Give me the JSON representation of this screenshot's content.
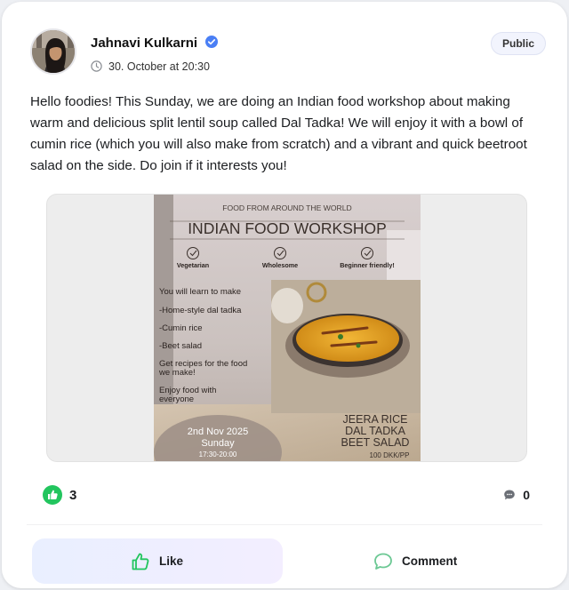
{
  "post": {
    "author_name": "Jahnavi Kulkarni",
    "timestamp": "30. October at 20:30",
    "visibility": "Public",
    "body": "Hello foodies! This Sunday, we are doing an Indian food workshop about making warm and delicious split lentil soup called Dal Tadka! We will enjoy it with a bowl of cumin rice (which you will also make from scratch) and a vibrant and quick beetroot salad on the side. Do join if it interests you!"
  },
  "poster": {
    "kicker": "FOOD FROM AROUND THE WORLD",
    "title": "INDIAN FOOD WORKSHOP",
    "features": [
      "Vegetarian",
      "Wholesome",
      "Beginner friendly!"
    ],
    "learn_heading": "You will learn to make",
    "learn_items": [
      "-Home-style dal tadka",
      "-Cumin rice",
      "-Beet salad"
    ],
    "recipes_line1": "Get recipes for the food",
    "recipes_line2": "we make!",
    "enjoy_line1": "Enjoy food with",
    "enjoy_line2": "everyone",
    "date": "2nd Nov 2025",
    "day": "Sunday",
    "time": "17:30-20:00",
    "menu": [
      "JEERA RICE",
      "DAL TADKA",
      "BEET SALAD"
    ],
    "price": "100 DKK/PP"
  },
  "reactions": {
    "like_count": "3",
    "comment_count": "0"
  },
  "actions": {
    "like_label": "Like",
    "comment_label": "Comment"
  },
  "colors": {
    "verified": "#4a7ff5",
    "like_green": "#22c55e",
    "comment_green": "#6cc894"
  },
  "icons": [
    "verified-check-icon",
    "clock-icon",
    "thumbs-up-icon",
    "comment-bubble-icon"
  ]
}
